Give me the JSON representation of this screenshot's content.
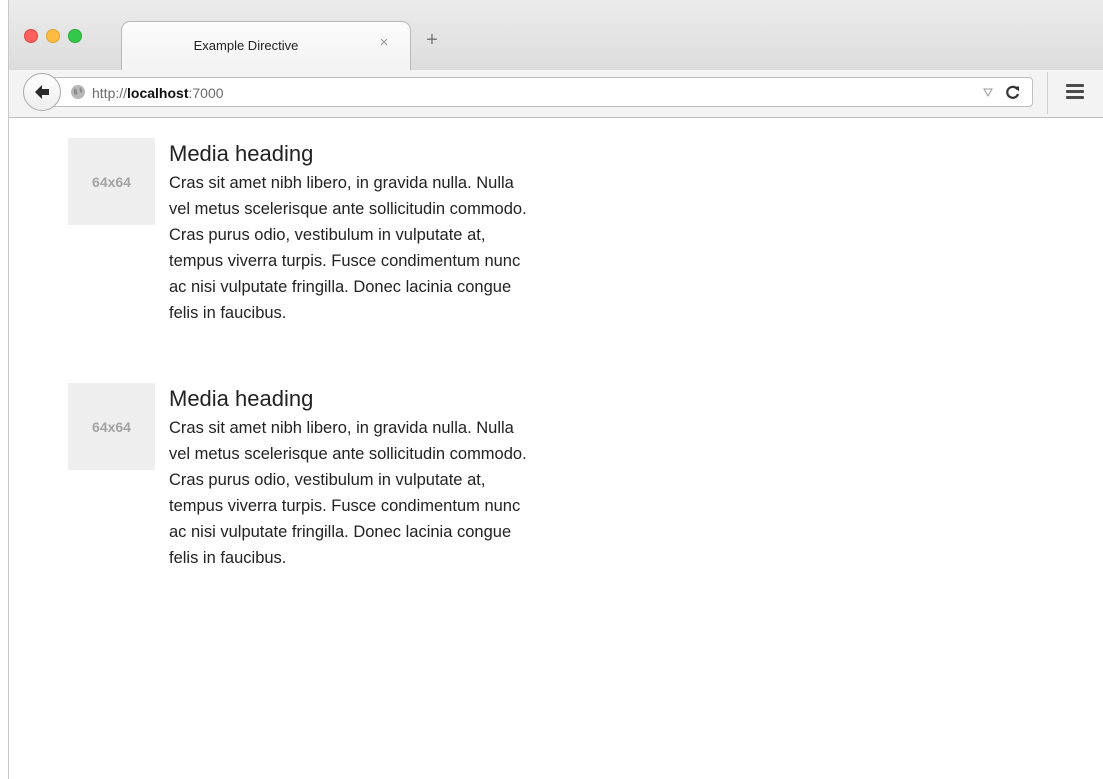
{
  "browser": {
    "tab_title": "Example Directive",
    "tab_close_glyph": "×",
    "new_tab_glyph": "+",
    "url_scheme": "http://",
    "url_host": "localhost",
    "url_port": ":7000"
  },
  "icons": {
    "back": "back-arrow-icon",
    "site": "globe-icon",
    "dropdown": "dropdown-triangle-icon",
    "reload": "reload-icon",
    "menu": "hamburger-menu-icon"
  },
  "colors": {
    "close": "#fc605c",
    "minimize": "#fdbc40",
    "maximize": "#34c84a",
    "placeholder_bg": "#eeeeee",
    "placeholder_text": "#a3a3a3"
  },
  "media": [
    {
      "thumb_label": "64x64",
      "heading": "Media heading",
      "body": "Cras sit amet nibh libero, in gravida nulla. Nulla vel metus scelerisque ante sollicitudin commodo. Cras purus odio, vestibulum in vulputate at, tempus viverra turpis. Fusce condimentum nunc ac nisi vulputate fringilla. Donec lacinia congue felis in faucibus."
    },
    {
      "thumb_label": "64x64",
      "heading": "Media heading",
      "body": "Cras sit amet nibh libero, in gravida nulla. Nulla vel metus scelerisque ante sollicitudin commodo. Cras purus odio, vestibulum in vulputate at, tempus viverra turpis. Fusce condimentum nunc ac nisi vulputate fringilla. Donec lacinia congue felis in faucibus."
    }
  ]
}
